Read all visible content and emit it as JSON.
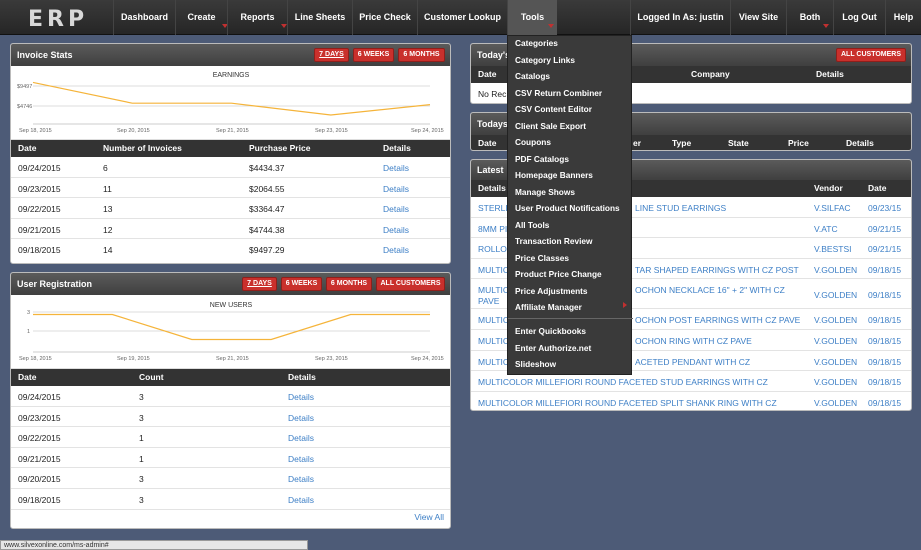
{
  "nav": {
    "logo": "ERP",
    "dashboard": "Dashboard",
    "create": "Create",
    "reports": "Reports",
    "line_sheets": "Line Sheets",
    "price_check": "Price Check",
    "customer_lookup": "Customer Lookup",
    "tools": "Tools",
    "logged_in": "Logged In As: justin",
    "view_site": "View Site",
    "both": "Both",
    "log_out": "Log Out",
    "help": "Help"
  },
  "invoice_stats": {
    "title": "Invoice Stats",
    "buttons": [
      "7 DAYS",
      "6 WEEKS",
      "6 MONTHS"
    ],
    "chart_title": "EARNINGS",
    "columns": [
      "Date",
      "Number of Invoices",
      "Purchase Price",
      "Details"
    ],
    "rows": [
      {
        "date": "09/24/2015",
        "count": "6",
        "price": "$4434.37",
        "details": "Details"
      },
      {
        "date": "09/23/2015",
        "count": "11",
        "price": "$2064.55",
        "details": "Details"
      },
      {
        "date": "09/22/2015",
        "count": "13",
        "price": "$3364.47",
        "details": "Details"
      },
      {
        "date": "09/21/2015",
        "count": "12",
        "price": "$4744.38",
        "details": "Details"
      },
      {
        "date": "09/18/2015",
        "count": "14",
        "price": "$9497.29",
        "details": "Details"
      }
    ]
  },
  "user_registration": {
    "title": "User Registration",
    "buttons": [
      "7 DAYS",
      "6 WEEKS",
      "6 MONTHS",
      "ALL CUSTOMERS"
    ],
    "chart_title": "NEW USERS",
    "columns": [
      "Date",
      "Count",
      "Details"
    ],
    "rows": [
      {
        "date": "09/24/2015",
        "count": "3",
        "details": "Details"
      },
      {
        "date": "09/23/2015",
        "count": "3",
        "details": "Details"
      },
      {
        "date": "09/22/2015",
        "count": "1",
        "details": "Details"
      },
      {
        "date": "09/21/2015",
        "count": "1",
        "details": "Details"
      },
      {
        "date": "09/20/2015",
        "count": "3",
        "details": "Details"
      },
      {
        "date": "09/18/2015",
        "count": "3",
        "details": "Details"
      }
    ],
    "view_all": "View All"
  },
  "todays_panel": {
    "title": "Today's",
    "button": "ALL CUSTOMERS",
    "columns": [
      "Date",
      "Company",
      "Details"
    ],
    "empty": "No Rec"
  },
  "todays_panel2": {
    "title": "Todays",
    "columns": [
      "Date",
      "er",
      "Type",
      "State",
      "Price",
      "Details"
    ]
  },
  "latest_panel": {
    "title": "Latest",
    "columns": [
      "Details",
      "Vendor",
      "Date"
    ],
    "rows": [
      {
        "name": "STERLI",
        "name2": "LINE STUD EARRINGS",
        "vendor": "V.SILFAC",
        "date": "09/23/15"
      },
      {
        "name": "8MM PI",
        "name2": "",
        "vendor": "V.ATC",
        "date": "09/21/15"
      },
      {
        "name": "ROLLO",
        "name2": "",
        "vendor": "V.BESTSI",
        "date": "09/21/15"
      },
      {
        "name": "MULTIC",
        "name2": "TAR SHAPED EARRINGS WITH CZ POST",
        "vendor": "V.GOLDEN",
        "date": "09/18/15"
      },
      {
        "name": "MULTIC",
        "name2": "OCHON NECKLACE 16\" + 2\" WITH CZ",
        "name3": "PAVE",
        "vendor": "V.GOLDEN",
        "date": "09/18/15"
      },
      {
        "name": "MULTIC",
        "name2": "OCHON POST EARRINGS WITH CZ PAVE",
        "vendor": "V.GOLDEN",
        "date": "09/18/15"
      },
      {
        "name": "MULTIC",
        "name2": "OCHON RING WITH CZ PAVE",
        "vendor": "V.GOLDEN",
        "date": "09/18/15"
      },
      {
        "name": "MULTIC",
        "name2": "ACETED PENDANT WITH CZ",
        "vendor": "V.GOLDEN",
        "date": "09/18/15"
      },
      {
        "name": "MULTICOLOR MILLEFIORI ROUND FACETED STUD EARRINGS WITH CZ",
        "name2": "",
        "vendor": "V.GOLDEN",
        "date": "09/18/15"
      },
      {
        "name": "MULTICOLOR MILLEFIORI ROUND FACETED SPLIT SHANK RING WITH CZ",
        "name2": "",
        "vendor": "V.GOLDEN",
        "date": "09/18/15"
      }
    ]
  },
  "tools_menu": {
    "group1": [
      "Categories",
      "Category Links",
      "Catalogs",
      "CSV Return Combiner",
      "CSV Content Editor",
      "Client Sale Export",
      "Coupons",
      "PDF Catalogs",
      "Homepage Banners",
      "Manage Shows",
      "User Product Notifications",
      "All Tools",
      "Transaction Review",
      "Price Classes",
      "Product Price Change",
      "Price Adjustments",
      "Affiliate Manager"
    ],
    "group2": [
      "Enter Quickbooks",
      "Enter Authorize.net",
      "Slideshow"
    ]
  },
  "status_url": "www.silvexonline.com/ms-admin#",
  "chart_data": [
    {
      "type": "line",
      "title": "EARNINGS",
      "x": [
        "Sep 18, 2015",
        "Sep 20, 2015",
        "Sep 21, 2015",
        "Sep 23, 2015",
        "Sep 24, 2015"
      ],
      "series": [
        {
          "values": [
            9497,
            4746,
            4744,
            2064,
            4434
          ]
        }
      ],
      "ytick_labels": [
        "$9497",
        "$4746"
      ]
    },
    {
      "type": "line",
      "title": "NEW USERS",
      "x": [
        "Sep 18, 2015",
        "Sep 19, 2015",
        "Sep 21, 2015",
        "Sep 23, 2015",
        "Sep 24, 2015"
      ],
      "series": [
        {
          "values": [
            3,
            3,
            1,
            1,
            3,
            3
          ]
        }
      ],
      "ytick_labels": [
        "3",
        "1"
      ]
    }
  ]
}
